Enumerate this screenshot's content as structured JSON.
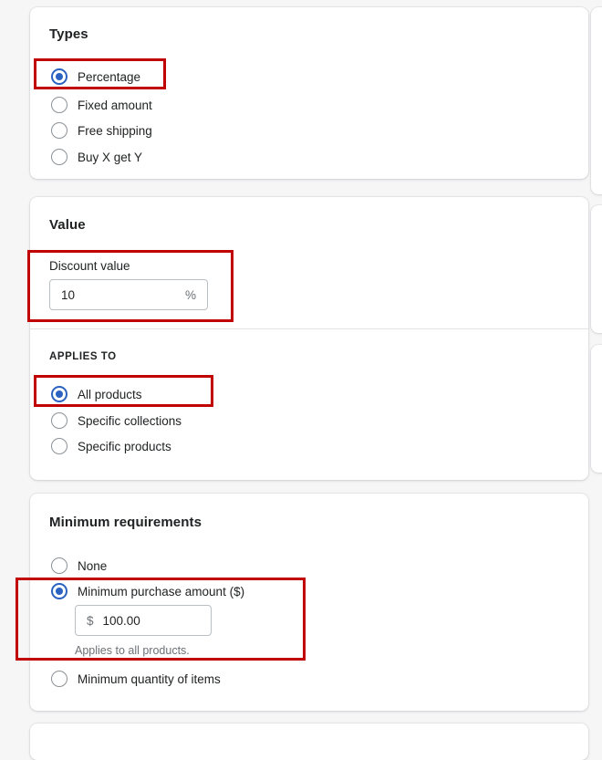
{
  "theme": {
    "page_background": "#f6f6f7",
    "card_background": "#ffffff",
    "accent": "#2b62c1",
    "text": "#202223",
    "subdued_text": "#6d7175",
    "border": "#babfc3",
    "divider": "#e1e3e5",
    "highlight": "#c00000"
  },
  "cards": {
    "types": {
      "title": "Types",
      "options": [
        {
          "label": "Percentage",
          "selected": true
        },
        {
          "label": "Fixed amount",
          "selected": false
        },
        {
          "label": "Free shipping",
          "selected": false
        },
        {
          "label": "Buy X get Y",
          "selected": false
        }
      ]
    },
    "value": {
      "title": "Value",
      "discount_value": {
        "label": "Discount value",
        "value": "10",
        "suffix": "%",
        "placeholder": "0"
      },
      "applies_to": {
        "caption": "APPLIES TO",
        "options": [
          {
            "label": "All products",
            "selected": true
          },
          {
            "label": "Specific collections",
            "selected": false
          },
          {
            "label": "Specific products",
            "selected": false
          }
        ]
      }
    },
    "minimum_requirements": {
      "title": "Minimum requirements",
      "options": [
        {
          "label": "None",
          "selected": false
        },
        {
          "label": "Minimum purchase amount ($)",
          "selected": true
        },
        {
          "label": "Minimum quantity of items",
          "selected": false
        }
      ],
      "amount_field": {
        "prefix": "$",
        "value": "100.00",
        "placeholder": "0.00"
      },
      "help_text": "Applies to all products."
    }
  },
  "highlights": [
    {
      "name": "highlight-percentage-option"
    },
    {
      "name": "highlight-discount-value-field"
    },
    {
      "name": "highlight-all-products-option"
    },
    {
      "name": "highlight-minimum-purchase-amount"
    }
  ]
}
